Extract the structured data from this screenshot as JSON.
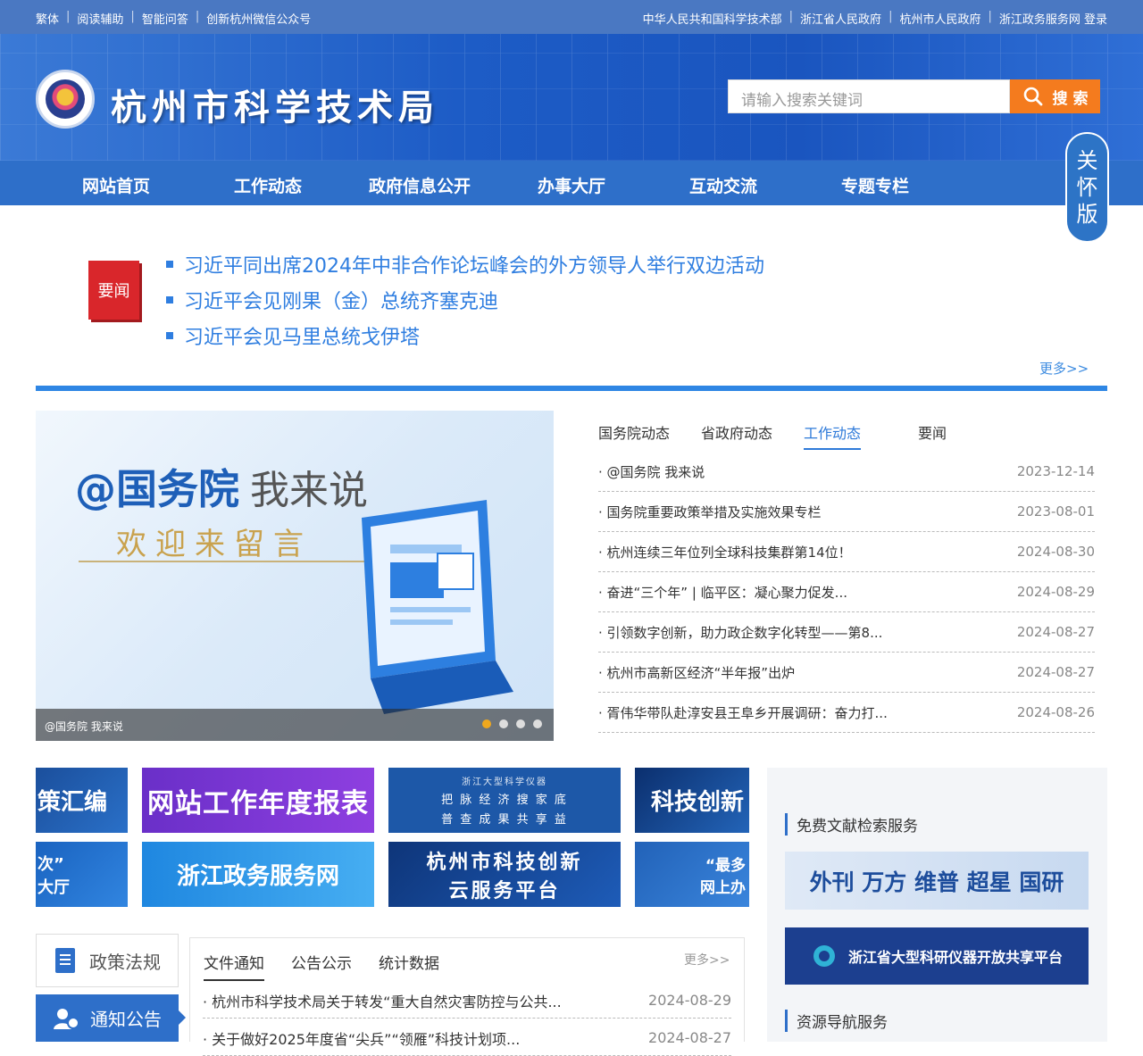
{
  "topbar": {
    "left": [
      "繁体",
      "阅读辅助",
      "智能问答",
      "创新杭州微信公众号"
    ],
    "right": [
      "中华人民共和国科学技术部",
      "浙江省人民政府",
      "杭州市人民政府",
      "浙江政务服务网 登录"
    ]
  },
  "header": {
    "site_name": "杭州市科学技术局",
    "search_placeholder": "请输入搜索关键词",
    "search_label": "搜 索"
  },
  "nav": [
    "网站首页",
    "工作动态",
    "政府信息公开",
    "办事大厅",
    "互动交流",
    "专题专栏"
  ],
  "care_mode": [
    "关",
    "怀",
    "版"
  ],
  "important": {
    "badge": "要闻",
    "items": [
      "习近平同出席2024年中非合作论坛峰会的外方领导人举行双边活动",
      "习近平会见刚果（金）总统齐塞克迪",
      "习近平会见马里总统戈伊塔"
    ],
    "more": "更多>>"
  },
  "banner": {
    "title_main": "@国务院",
    "title_sub": "我来说",
    "welcome": "欢迎来留言",
    "caption": "@国务院 我来说",
    "slide_count": 4,
    "active_slide": 1
  },
  "news": {
    "tabs": [
      "国务院动态",
      "省政府动态",
      "工作动态",
      "要闻"
    ],
    "active_tab": "工作动态",
    "items": [
      {
        "title": "@国务院 我来说",
        "date": "2023-12-14"
      },
      {
        "title": "国务院重要政策举措及实施效果专栏",
        "date": "2023-08-01"
      },
      {
        "title": "杭州连续三年位列全球科技集群第14位！",
        "date": "2024-08-30"
      },
      {
        "title": "奋进“三个年” | 临平区：凝心聚力促发...",
        "date": "2024-08-29"
      },
      {
        "title": "引领数字创新，助力政企数字化转型——第8...",
        "date": "2024-08-27"
      },
      {
        "title": "杭州市高新区经济“半年报”出炉",
        "date": "2024-08-27"
      },
      {
        "title": "胥伟华带队赴淳安县王阜乡开展调研：奋力打...",
        "date": "2024-08-26"
      }
    ]
  },
  "tiles": {
    "t1": "策汇编",
    "t2": "网站工作年度报表",
    "t3_top": "浙江大型科学仪器",
    "t3_a": "把 脉 经 济 搜 家 底",
    "t3_b": "普 查 成 果 共 享 益",
    "t4": "科技创新",
    "t5_a": "次”",
    "t5_b": "大厅",
    "t6": "浙江政务服务网",
    "t7_a": "杭州市科技创新",
    "t7_b": "云服务平台",
    "t8_a": "“最多",
    "t8_b": "网上办"
  },
  "right_panel": {
    "lit_title": "免费文献检索服务",
    "lit_banner": "外刊 万方 维普 超星 国研",
    "inst_banner": "浙江省大型科研仪器开放共享平台",
    "res_title": "资源导航服务"
  },
  "policy": {
    "btn1": "政策法规",
    "btn2": "通知公告"
  },
  "notice": {
    "tabs": [
      "文件通知",
      "公告公示",
      "统计数据"
    ],
    "active_tab": "文件通知",
    "more": "更多>>",
    "items": [
      {
        "title": "杭州市科学技术局关于转发“重大自然灾害防控与公共...",
        "date": "2024-08-29"
      },
      {
        "title": "关于做好2025年度省“尖兵”“领雁”科技计划项...",
        "date": "2024-08-27"
      }
    ]
  },
  "colors": {
    "brand_blue": "#2e6fc9",
    "accent_orange": "#f47b1e",
    "headline_blue": "#2f7ee0",
    "badge_red": "#d9262b"
  }
}
